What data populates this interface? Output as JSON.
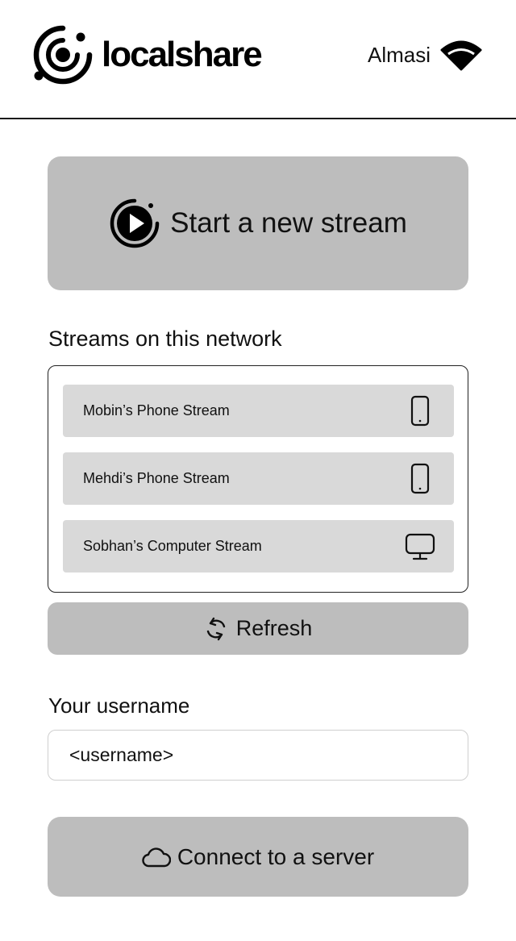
{
  "header": {
    "app_name": "localshare",
    "network_name": "Almasi"
  },
  "start_stream": {
    "label": "Start a new stream"
  },
  "streams": {
    "title": "Streams on this network",
    "items": [
      {
        "label": "Mobin’s Phone Stream",
        "device_icon": "phone-icon"
      },
      {
        "label": "Mehdi’s Phone Stream",
        "device_icon": "phone-icon"
      },
      {
        "label": "Sobhan’s Computer Stream",
        "device_icon": "monitor-icon"
      }
    ]
  },
  "refresh": {
    "label": "Refresh"
  },
  "username": {
    "title": "Your username",
    "placeholder": "<username>",
    "value": ""
  },
  "connect": {
    "label": "Connect to a server"
  }
}
